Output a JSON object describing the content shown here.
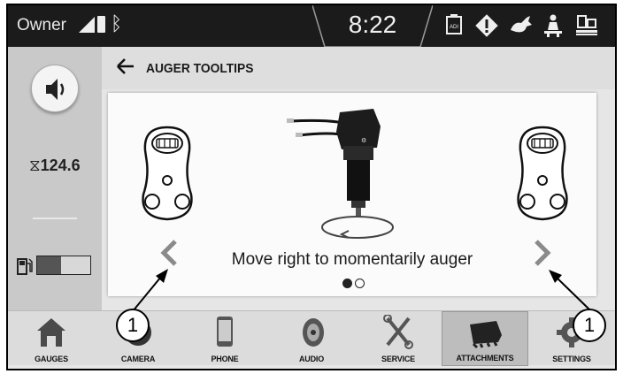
{
  "status_bar": {
    "profile": "Owner",
    "time": "8:22"
  },
  "left_panel": {
    "hours_value": "124.6",
    "fuel_level": 0.45
  },
  "header": {
    "title": "AUGER TOOLTIPS"
  },
  "card": {
    "caption": "Move right to momentarily auger",
    "page_count": 2,
    "current_page": 1
  },
  "nav": [
    {
      "label": "GAUGES",
      "icon": "home-icon"
    },
    {
      "label": "CAMERA",
      "icon": "camera-icon"
    },
    {
      "label": "PHONE",
      "icon": "phone-icon"
    },
    {
      "label": "AUDIO",
      "icon": "speaker-icon"
    },
    {
      "label": "SERVICE",
      "icon": "tools-icon"
    },
    {
      "label": "ATTACHMENTS",
      "icon": "bucket-icon",
      "active": true
    },
    {
      "label": "SETTINGS",
      "icon": "gear-icon"
    }
  ],
  "callouts": [
    "1",
    "1"
  ]
}
